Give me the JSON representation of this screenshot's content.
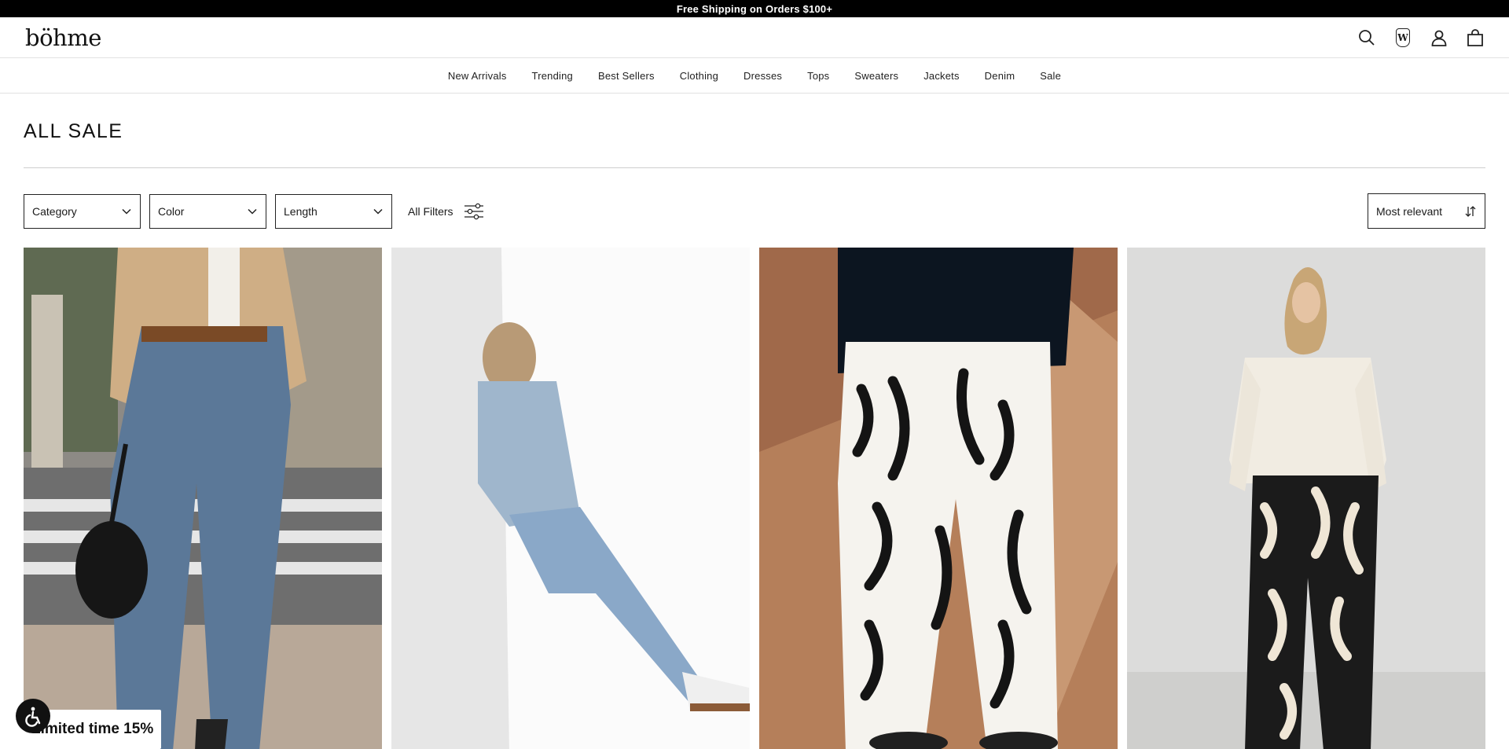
{
  "announcement": "Free Shipping on Orders $100+",
  "brand": "böhme",
  "header_icons": [
    "search-icon",
    "wishlist-icon",
    "account-icon",
    "cart-icon"
  ],
  "wishlist_glyph": "W",
  "nav": [
    "New Arrivals",
    "Trending",
    "Best Sellers",
    "Clothing",
    "Dresses",
    "Tops",
    "Sweaters",
    "Jackets",
    "Denim",
    "Sale"
  ],
  "page_title": "ALL SALE",
  "filters": {
    "category": "Category",
    "color": "Color",
    "length": "Length",
    "all_filters": "All Filters"
  },
  "sort": {
    "selected": "Most relevant"
  },
  "products": [
    {
      "image": "model in beige cropped trench jacket and blue barrel jeans with black bag"
    },
    {
      "image": "model leaning against white wall in denim jacket and embellished jeans"
    },
    {
      "image": "model in black shirt and black-and-white abstract print wide-leg pants"
    },
    {
      "image": "model in cream ruched top and black-and-cream abstract print pants"
    }
  ],
  "promo": "Limited time 15%",
  "colors": {
    "announcement_bg": "#000000",
    "border": "#222222",
    "divider": "#cfcfcf"
  }
}
